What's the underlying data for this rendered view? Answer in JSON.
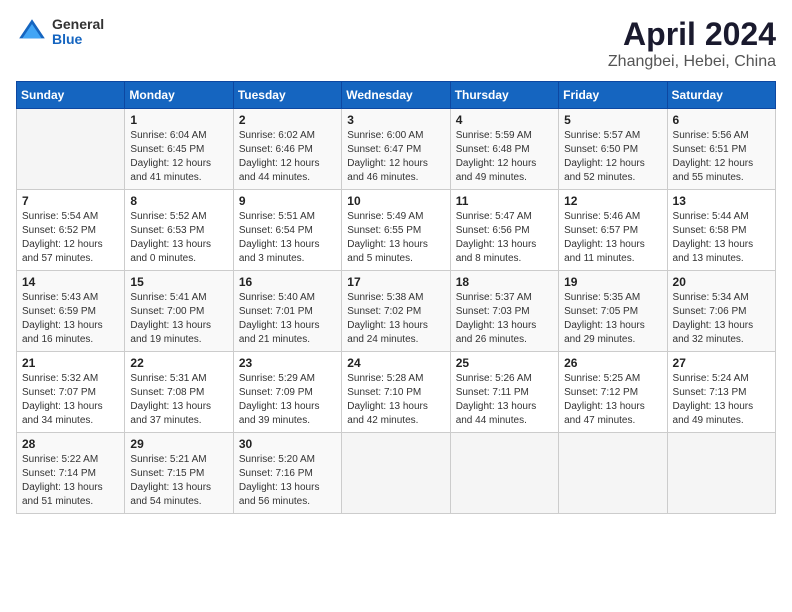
{
  "header": {
    "logo_general": "General",
    "logo_blue": "Blue",
    "title": "April 2024",
    "subtitle": "Zhangbei, Hebei, China"
  },
  "weekdays": [
    "Sunday",
    "Monday",
    "Tuesday",
    "Wednesday",
    "Thursday",
    "Friday",
    "Saturday"
  ],
  "weeks": [
    [
      {
        "day": "",
        "info": ""
      },
      {
        "day": "1",
        "info": "Sunrise: 6:04 AM\nSunset: 6:45 PM\nDaylight: 12 hours\nand 41 minutes."
      },
      {
        "day": "2",
        "info": "Sunrise: 6:02 AM\nSunset: 6:46 PM\nDaylight: 12 hours\nand 44 minutes."
      },
      {
        "day": "3",
        "info": "Sunrise: 6:00 AM\nSunset: 6:47 PM\nDaylight: 12 hours\nand 46 minutes."
      },
      {
        "day": "4",
        "info": "Sunrise: 5:59 AM\nSunset: 6:48 PM\nDaylight: 12 hours\nand 49 minutes."
      },
      {
        "day": "5",
        "info": "Sunrise: 5:57 AM\nSunset: 6:50 PM\nDaylight: 12 hours\nand 52 minutes."
      },
      {
        "day": "6",
        "info": "Sunrise: 5:56 AM\nSunset: 6:51 PM\nDaylight: 12 hours\nand 55 minutes."
      }
    ],
    [
      {
        "day": "7",
        "info": "Sunrise: 5:54 AM\nSunset: 6:52 PM\nDaylight: 12 hours\nand 57 minutes."
      },
      {
        "day": "8",
        "info": "Sunrise: 5:52 AM\nSunset: 6:53 PM\nDaylight: 13 hours\nand 0 minutes."
      },
      {
        "day": "9",
        "info": "Sunrise: 5:51 AM\nSunset: 6:54 PM\nDaylight: 13 hours\nand 3 minutes."
      },
      {
        "day": "10",
        "info": "Sunrise: 5:49 AM\nSunset: 6:55 PM\nDaylight: 13 hours\nand 5 minutes."
      },
      {
        "day": "11",
        "info": "Sunrise: 5:47 AM\nSunset: 6:56 PM\nDaylight: 13 hours\nand 8 minutes."
      },
      {
        "day": "12",
        "info": "Sunrise: 5:46 AM\nSunset: 6:57 PM\nDaylight: 13 hours\nand 11 minutes."
      },
      {
        "day": "13",
        "info": "Sunrise: 5:44 AM\nSunset: 6:58 PM\nDaylight: 13 hours\nand 13 minutes."
      }
    ],
    [
      {
        "day": "14",
        "info": "Sunrise: 5:43 AM\nSunset: 6:59 PM\nDaylight: 13 hours\nand 16 minutes."
      },
      {
        "day": "15",
        "info": "Sunrise: 5:41 AM\nSunset: 7:00 PM\nDaylight: 13 hours\nand 19 minutes."
      },
      {
        "day": "16",
        "info": "Sunrise: 5:40 AM\nSunset: 7:01 PM\nDaylight: 13 hours\nand 21 minutes."
      },
      {
        "day": "17",
        "info": "Sunrise: 5:38 AM\nSunset: 7:02 PM\nDaylight: 13 hours\nand 24 minutes."
      },
      {
        "day": "18",
        "info": "Sunrise: 5:37 AM\nSunset: 7:03 PM\nDaylight: 13 hours\nand 26 minutes."
      },
      {
        "day": "19",
        "info": "Sunrise: 5:35 AM\nSunset: 7:05 PM\nDaylight: 13 hours\nand 29 minutes."
      },
      {
        "day": "20",
        "info": "Sunrise: 5:34 AM\nSunset: 7:06 PM\nDaylight: 13 hours\nand 32 minutes."
      }
    ],
    [
      {
        "day": "21",
        "info": "Sunrise: 5:32 AM\nSunset: 7:07 PM\nDaylight: 13 hours\nand 34 minutes."
      },
      {
        "day": "22",
        "info": "Sunrise: 5:31 AM\nSunset: 7:08 PM\nDaylight: 13 hours\nand 37 minutes."
      },
      {
        "day": "23",
        "info": "Sunrise: 5:29 AM\nSunset: 7:09 PM\nDaylight: 13 hours\nand 39 minutes."
      },
      {
        "day": "24",
        "info": "Sunrise: 5:28 AM\nSunset: 7:10 PM\nDaylight: 13 hours\nand 42 minutes."
      },
      {
        "day": "25",
        "info": "Sunrise: 5:26 AM\nSunset: 7:11 PM\nDaylight: 13 hours\nand 44 minutes."
      },
      {
        "day": "26",
        "info": "Sunrise: 5:25 AM\nSunset: 7:12 PM\nDaylight: 13 hours\nand 47 minutes."
      },
      {
        "day": "27",
        "info": "Sunrise: 5:24 AM\nSunset: 7:13 PM\nDaylight: 13 hours\nand 49 minutes."
      }
    ],
    [
      {
        "day": "28",
        "info": "Sunrise: 5:22 AM\nSunset: 7:14 PM\nDaylight: 13 hours\nand 51 minutes."
      },
      {
        "day": "29",
        "info": "Sunrise: 5:21 AM\nSunset: 7:15 PM\nDaylight: 13 hours\nand 54 minutes."
      },
      {
        "day": "30",
        "info": "Sunrise: 5:20 AM\nSunset: 7:16 PM\nDaylight: 13 hours\nand 56 minutes."
      },
      {
        "day": "",
        "info": ""
      },
      {
        "day": "",
        "info": ""
      },
      {
        "day": "",
        "info": ""
      },
      {
        "day": "",
        "info": ""
      }
    ]
  ]
}
